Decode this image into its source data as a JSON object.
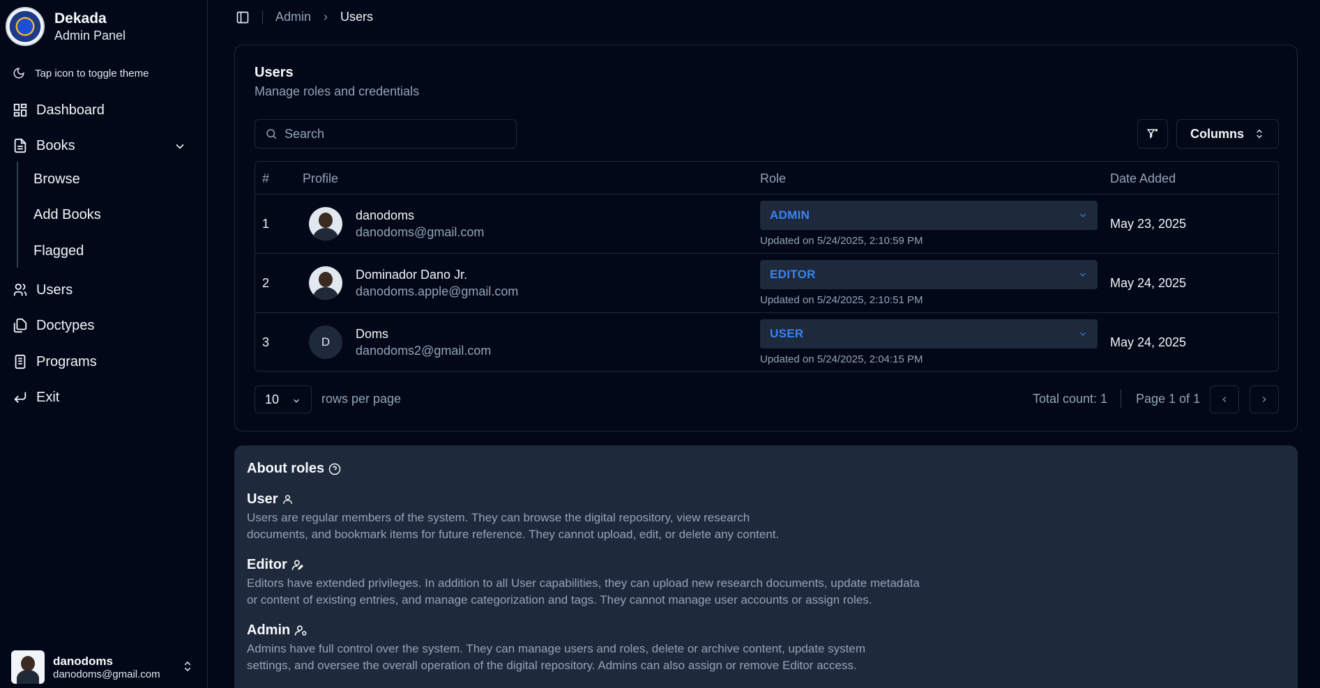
{
  "sidebar": {
    "brand_title": "Dekada",
    "brand_subtitle": "Admin Panel",
    "theme_hint": "Tap icon to toggle theme",
    "items": [
      {
        "label": "Dashboard",
        "icon": "dashboard-icon"
      },
      {
        "label": "Books",
        "icon": "file-text-icon"
      },
      {
        "label": "Users",
        "icon": "users-icon"
      },
      {
        "label": "Doctypes",
        "icon": "files-icon"
      },
      {
        "label": "Programs",
        "icon": "library-icon"
      },
      {
        "label": "Exit",
        "icon": "corner-down-left-icon"
      }
    ],
    "books_sub": [
      "Browse",
      "Add Books",
      "Flagged"
    ],
    "user": {
      "name": "danodoms",
      "email": "danodoms@gmail.com"
    }
  },
  "breadcrumb": {
    "parent": "Admin",
    "current": "Users"
  },
  "card": {
    "title": "Users",
    "description": "Manage roles and credentials",
    "search_placeholder": "Search",
    "columns_label": "Columns"
  },
  "table": {
    "headers": [
      "#",
      "Profile",
      "Role",
      "Date Added"
    ],
    "rows": [
      {
        "num": "1",
        "name": "danodoms",
        "email": "danodoms@gmail.com",
        "role": "ADMIN",
        "updated": "Updated on 5/24/2025, 2:10:59 PM",
        "date": "May 23, 2025",
        "avatar": "photo"
      },
      {
        "num": "2",
        "name": "Dominador Dano Jr.",
        "email": "danodoms.apple@gmail.com",
        "role": "EDITOR",
        "updated": "Updated on 5/24/2025, 2:10:51 PM",
        "date": "May 24, 2025",
        "avatar": "photo"
      },
      {
        "num": "3",
        "name": "Doms",
        "email": "danodoms2@gmail.com",
        "role": "USER",
        "updated": "Updated on 5/24/2025, 2:04:15 PM",
        "date": "May 24, 2025",
        "avatar": "D"
      }
    ]
  },
  "pagination": {
    "rows_per_page": "10",
    "rows_label": "rows per page",
    "total": "Total count: 1",
    "page": "Page 1 of 1"
  },
  "about": {
    "title": "About roles",
    "roles": [
      {
        "name": "User",
        "text1": "Users are regular members of the system. They can browse the digital repository, view research",
        "text2": "documents, and bookmark items for future reference. They cannot upload, edit, or delete any content."
      },
      {
        "name": "Editor",
        "text1": "Editors have extended privileges. In addition to all User capabilities, they can upload new research documents, update metadata",
        "text2": "or content of existing entries, and manage categorization and tags. They cannot manage user accounts or assign roles."
      },
      {
        "name": "Admin",
        "text1": "Admins have full control over the system. They can manage users and roles, delete or archive content, update system",
        "text2": "settings, and oversee the overall operation of the digital repository. Admins can also assign or remove Editor access."
      }
    ]
  },
  "colors": {
    "background": "#020817",
    "panel": "#1e293b",
    "accent": "#3b82f6",
    "muted": "#94a3b8"
  }
}
